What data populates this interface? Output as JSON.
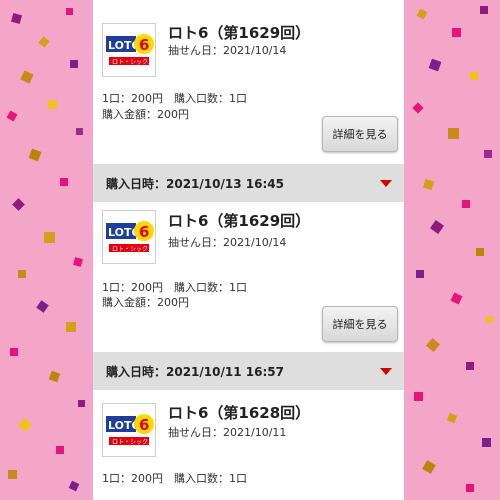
{
  "colors": {
    "background": "#f4a6c8",
    "panel": "#ffffff",
    "date_bar": "#dedede",
    "caret": "#d40000",
    "logo_red": "#e60012",
    "logo_blue": "#1d3f9b",
    "logo_yellow": "#ffd800"
  },
  "icons": [
    "loto6-logo",
    "caret-down-icon"
  ],
  "labels": {
    "detail_button": "詳細を見る",
    "purchase_datetime_prefix": "購入日時："
  },
  "logo": {
    "wordmark": "LOTO6",
    "kana": "ロト・シックス"
  },
  "tickets": [
    {
      "title": "ロト6（第1629回）",
      "draw_date": "抽せん日：2021/10/14",
      "quantity": "1口：200円　購入口数：1口",
      "amount": "購入金額：200円"
    },
    {
      "purchase_datetime": "購入日時：2021/10/13 16:45",
      "title": "ロト6（第1629回）",
      "draw_date": "抽せん日：2021/10/14",
      "quantity": "1口：200円　購入口数：1口",
      "amount": "購入金額：200円"
    },
    {
      "purchase_datetime": "購入日時：2021/10/11 16:57",
      "title": "ロト6（第1628回）",
      "draw_date": "抽せん日：2021/10/11",
      "quantity": "1口：200円　購入口数：1口"
    }
  ]
}
